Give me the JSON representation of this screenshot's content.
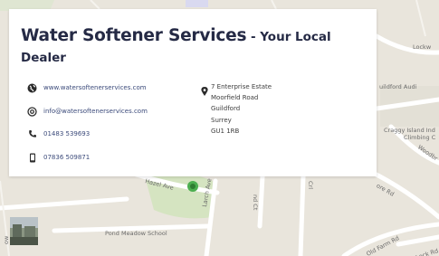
{
  "card": {
    "title": "Water Softener Services",
    "title_suffix": " - Your Local Dealer",
    "website": "www.watersoftenerservices.com",
    "email": "info@watersoftenerservices.com",
    "phone": "01483 539693",
    "mobile": "07836 509871",
    "address": [
      "7 Enterprise Estate",
      "Moorfield Road",
      "Guildford",
      "Surrey",
      "GU1 1RB"
    ]
  },
  "map": {
    "labels": {
      "hazel_ave": "Hazel Ave",
      "larch_ave": "Larch Ave",
      "pond_meadow": "Pond Meadow School",
      "crl": "Crl",
      "oldfarm": "Old Farm Rd",
      "lock_rd": "Lock Rd",
      "moore_rd": "ore Rd",
      "guildford_audi": "uildford Audi",
      "craggy": "Craggy Island Ind",
      "climbing": "Climbing C",
      "woodbr": "Woodbr",
      "lockw": "Lockw",
      "nd_ct": "nd Ct",
      "ow": "ow"
    }
  },
  "colors": {
    "title": "#252a45",
    "link": "#3b4a7a",
    "map_bg": "#e9e5dc",
    "park": "#c8dfb0"
  },
  "icons": [
    "globe-icon",
    "at-icon",
    "phone-icon",
    "mobile-icon",
    "pin-icon"
  ]
}
